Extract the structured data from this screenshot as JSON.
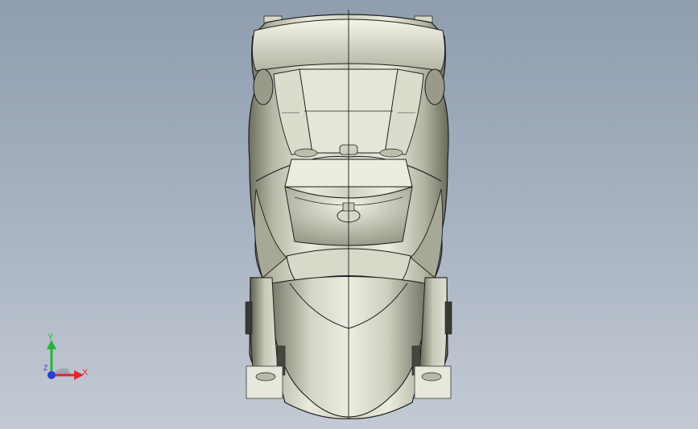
{
  "viewport": {
    "background_top": "#8f9dae",
    "background_bottom": "#c3cad3"
  },
  "model": {
    "body_color": "#c9c9b9",
    "edge_color": "#1c1c1c"
  },
  "triad": {
    "x_label": "X",
    "y_label": "Y",
    "z_label": "Z",
    "x_color": "#e3262c",
    "y_color": "#28b43c",
    "z_color": "#2a3bd6"
  }
}
